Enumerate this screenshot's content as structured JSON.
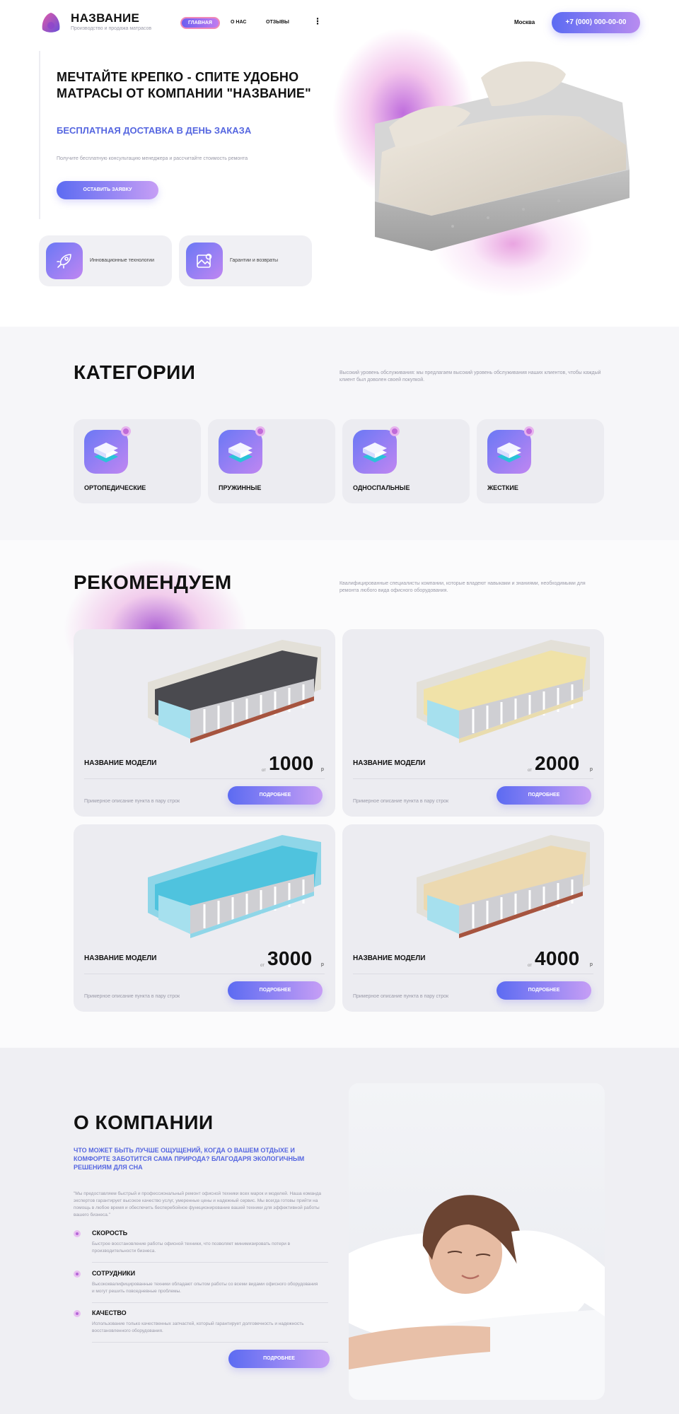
{
  "header": {
    "brand": "НАЗВАНИЕ",
    "tagline": "Производство и продажа матрасов",
    "nav": [
      "ГЛАВНАЯ",
      "О НАС",
      "ОТЗЫВЫ"
    ],
    "more": "⋮",
    "city": "Москва",
    "phone": "+7 (000) 000-00-00"
  },
  "hero": {
    "title": "МЕЧТАЙТЕ КРЕПКО - СПИТЕ УДОБНО МАТРАСЫ ОТ КОМПАНИИ \"НАЗВАНИЕ\"",
    "subtitle": "БЕСПЛАТНАЯ ДОСТАВКА В ДЕНЬ ЗАКАЗА",
    "note": "Получите бесплатную консультацию менеджера и рассчитайте стоимость ремонта",
    "cta": "ОСТАВИТЬ ЗАЯВКУ",
    "features": [
      {
        "icon": "rocket-icon",
        "label": "Инновационные технологии"
      },
      {
        "icon": "image-icon",
        "label": "Гарантии и возвраты"
      }
    ]
  },
  "categories": {
    "heading": "КАТЕГОРИИ",
    "description": "Высокий уровень обслуживания: мы предлагаем высокий уровень обслуживания наших клиентов, чтобы каждый клиент был доволен своей покупкой.",
    "items": [
      {
        "label": "ОРТОПЕДИЧЕСКИЕ",
        "icon": "mattress-layers-icon"
      },
      {
        "label": "ПРУЖИННЫЕ",
        "icon": "mattress-layers-icon"
      },
      {
        "label": "ОДНОСПАЛЬНЫЕ",
        "icon": "mattress-layers-icon"
      },
      {
        "label": "ЖЕСТКИЕ",
        "icon": "mattress-layers-icon"
      }
    ]
  },
  "recommend": {
    "heading": "РЕКОМЕНДУЕМ",
    "description": "Квалифицированные специалисты компании, которые владеют навыками и знаниями, необходимыми для ремонта любого вида офисного оборудования.",
    "products": [
      {
        "name": "НАЗВАНИЕ МОДЕЛИ",
        "from": "от",
        "price": "1000",
        "currency": "р",
        "desc": "Примерное описание пункта в пару строк",
        "button": "ПОДРОБНЕЕ"
      },
      {
        "name": "НАЗВАНИЕ МОДЕЛИ",
        "from": "от",
        "price": "2000",
        "currency": "р",
        "desc": "Примерное описание пункта в пару строк",
        "button": "ПОДРОБНЕЕ"
      },
      {
        "name": "НАЗВАНИЕ МОДЕЛИ",
        "from": "от",
        "price": "3000",
        "currency": "р",
        "desc": "Примерное описание пункта в пару строк",
        "button": "ПОДРОБНЕЕ"
      },
      {
        "name": "НАЗВАНИЕ МОДЕЛИ",
        "from": "от",
        "price": "4000",
        "currency": "р",
        "desc": "Примерное описание пункта в пару строк",
        "button": "ПОДРОБНЕЕ"
      }
    ]
  },
  "about": {
    "heading": "О КОМПАНИИ",
    "subtitle": "ЧТО МОЖЕТ БЫТЬ ЛУЧШЕ ОЩУЩЕНИЙ, КОГДА О ВАШЕМ ОТДЫХЕ И КОМФОРТЕ ЗАБОТИТСЯ САМА ПРИРОДА? БЛАГОДАРЯ ЭКОЛОГИЧНЫМ РЕШЕНИЯМ ДЛЯ СНА",
    "quote": "\"Мы предоставляем быстрый и профессиональный ремонт офисной техники всех марок и моделей. Наша команда экспертов гарантирует высокое качество услуг, умеренные цены и надежный сервис. Мы всегда готовы прийти на помощь в любое время и обеспечить бесперебойное функционирование вашей техники для эффективной работы вашего бизнеса.\"",
    "items": [
      {
        "title": "СКОРОСТЬ",
        "text": "Быстрое восстановление работы офисной техники, что позволяет минимизировать потери в производительности бизнеса."
      },
      {
        "title": "СОТРУДНИКИ",
        "text": "Высококвалифицированные техники обладают опытом работы со всеми видами офисного оборудования и могут решить повседневные проблемы."
      },
      {
        "title": "КАЧЕСТВО",
        "text": "Использование только качественных запчастей, который гарантирует долговечность и надежность восстановленного оборудования."
      }
    ],
    "button": "ПОДРОБНЕЕ"
  },
  "colors": {
    "accent": "#5566e0",
    "gradient_start": "#5c6bf2",
    "gradient_end": "#c69ef5",
    "glow": "#b04fd8"
  }
}
